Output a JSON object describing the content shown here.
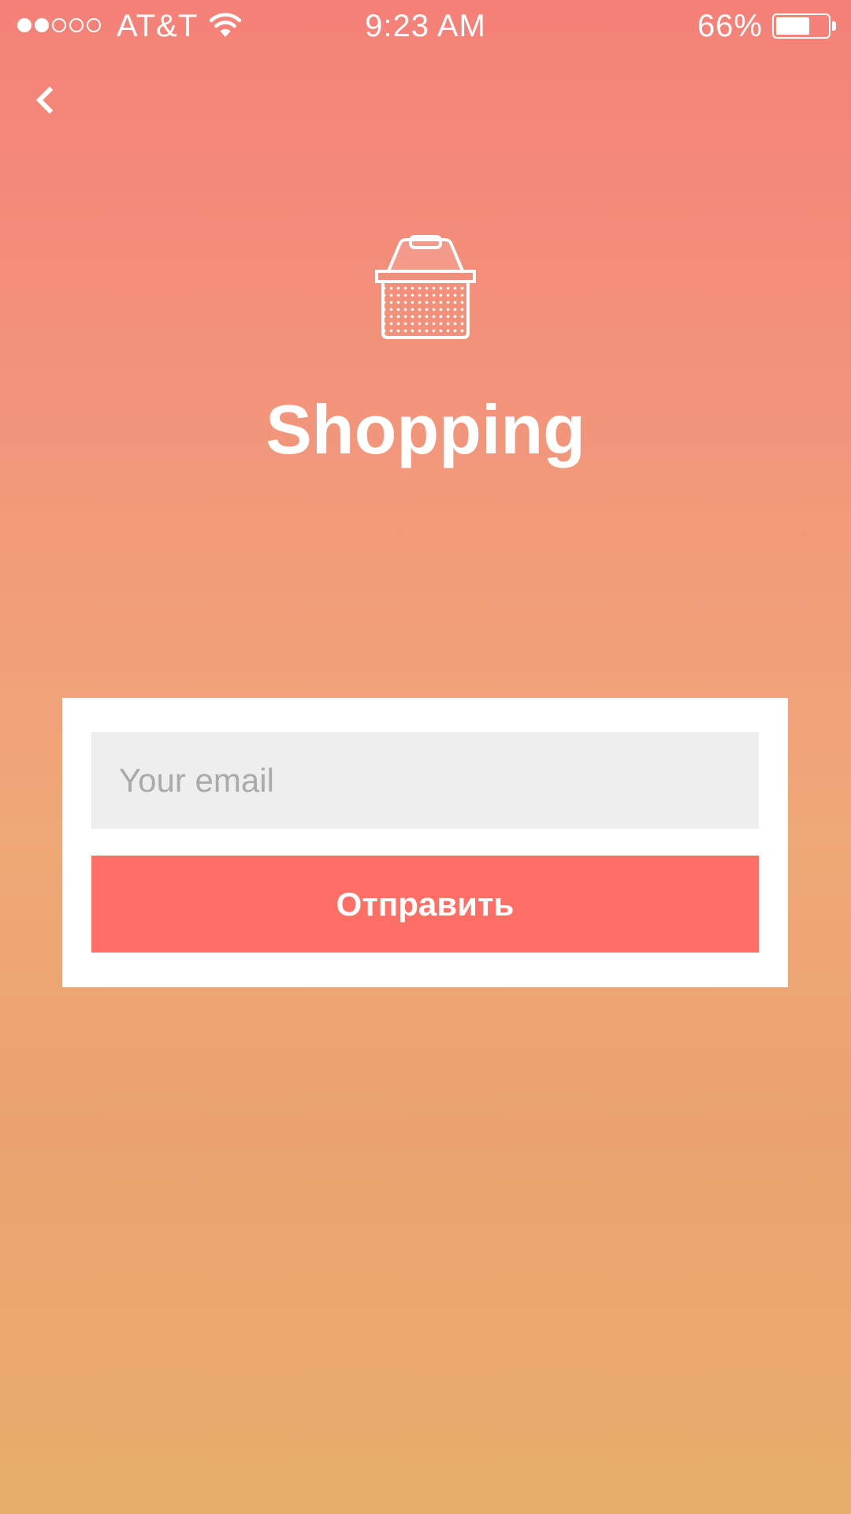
{
  "status_bar": {
    "signal_filled": 2,
    "signal_total": 5,
    "carrier": "AT&T",
    "time": "9:23 AM",
    "battery_percent_label": "66%",
    "battery_level": 0.66,
    "wifi_icon": "wifi-icon"
  },
  "nav": {
    "back_icon": "chevron-left-icon"
  },
  "hero": {
    "icon": "shopping-basket-icon",
    "title": "Shopping"
  },
  "form": {
    "email_placeholder": "Your email",
    "email_value": "",
    "submit_label": "Отправить"
  },
  "colors": {
    "gradient_top": "#f48178",
    "gradient_bottom": "#e8ad6c",
    "button": "#ff6f66",
    "input_background": "#eeeeee",
    "card": "#ffffff"
  }
}
